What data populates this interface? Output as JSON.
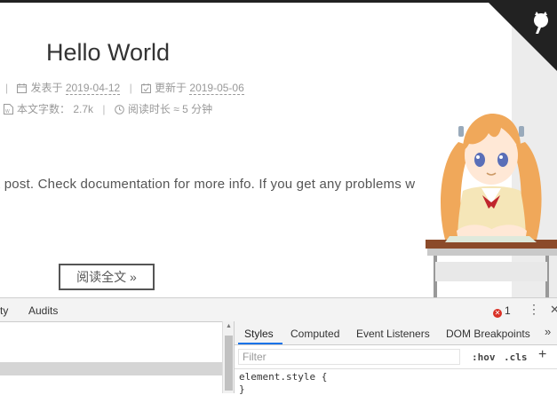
{
  "post": {
    "title": "Hello World",
    "posted_label": "发表于",
    "posted_date": "2019-04-12",
    "updated_label": "更新于",
    "updated_date": "2019-05-06",
    "wordcount_label": "本文字数：",
    "wordcount": "2.7k",
    "readtime_label": "阅读时长 ≈",
    "readtime": "5 分钟",
    "excerpt": "t post. Check documentation for more info. If you get any problems w",
    "read_more": "阅读全文 »"
  },
  "devtools": {
    "tabs": [
      "ty",
      "Audits"
    ],
    "error_count": "1",
    "error_icon": "error-circle-icon",
    "styles_tabs": [
      "Styles",
      "Computed",
      "Event Listeners",
      "DOM Breakpoints"
    ],
    "more_tabs": "»",
    "filter_placeholder": "Filter",
    "hov": ":hov",
    "cls": ".cls",
    "add": "+",
    "rule_open": "element.style {",
    "rule_close": "}",
    "kebab": "⋮",
    "close": "✕"
  },
  "colors": {
    "accent": "#1a73e8",
    "error": "#d93025",
    "corner": "#222222"
  }
}
